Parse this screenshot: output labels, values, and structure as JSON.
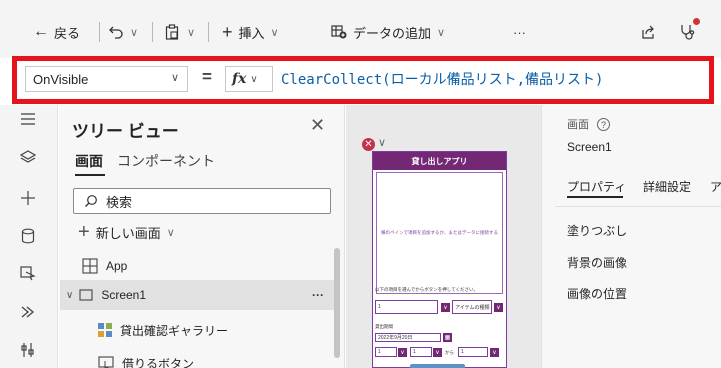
{
  "command_bar": {
    "back_label": "戻る",
    "insert_label": "挿入",
    "add_data_label": "データの追加",
    "more_label": "···"
  },
  "formula_bar": {
    "property_value": "OnVisible",
    "equals": "=",
    "fx_label": "fx",
    "formula": "ClearCollect(ローカル備品リスト,備品リスト)"
  },
  "tree_view": {
    "title": "ツリー ビュー",
    "tabs": [
      "画面",
      "コンポーネント"
    ],
    "search_placeholder": "検索",
    "new_screen_label": "新しい画面",
    "items": [
      {
        "label": "App"
      },
      {
        "label": "Screen1",
        "more": "···"
      },
      {
        "label": "貸出確認ギャラリー"
      },
      {
        "label": "借りるボタン"
      }
    ]
  },
  "canvas": {
    "app_title": "貸し出しアプリ",
    "gallery_hint": "横のペインで項目を追加するか、またはデータに接続する",
    "instruction_text": "以下の項目を選んでからボタンを押してください。",
    "quantity_value": "1",
    "item_name_label": "アイテムの種類",
    "period_label": "貸出期間",
    "date_value": "2022年9月20日",
    "from_label": "から",
    "num_values": [
      "1",
      "1",
      "1"
    ]
  },
  "right_pane": {
    "section_label": "画面",
    "screen_name": "Screen1",
    "tabs": [
      "プロパティ",
      "詳細設定",
      "ア"
    ],
    "properties": [
      "塗りつぶし",
      "背景の画像",
      "画像の位置"
    ]
  },
  "colors": {
    "accent_purple": "#742774",
    "highlight_red": "#e5131b",
    "formula_blue": "#0b5ea8"
  }
}
